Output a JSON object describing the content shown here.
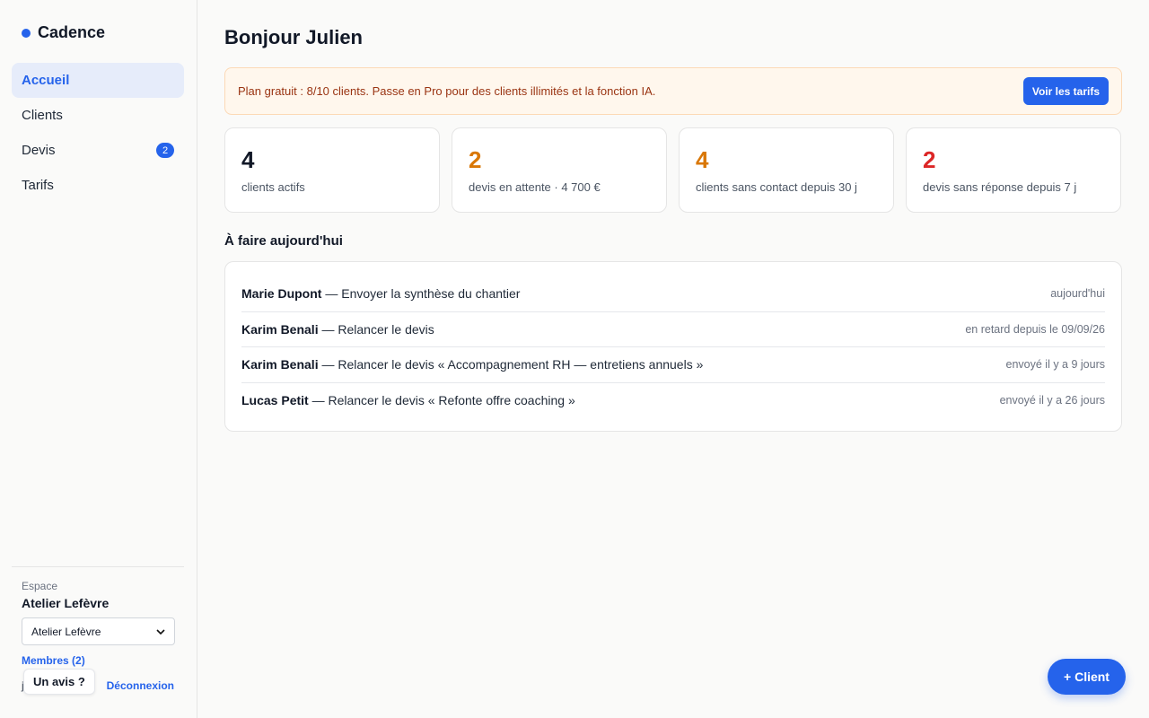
{
  "colors": {
    "accent": "#2563eb",
    "orange": "#d97706",
    "red": "#dc2626",
    "banner_bg": "#fff7ed",
    "banner_text": "#9a3412"
  },
  "sidebar": {
    "brand": "Cadence",
    "items": [
      {
        "label": "Accueil",
        "active": true,
        "badge": ""
      },
      {
        "label": "Clients",
        "active": false,
        "badge": ""
      },
      {
        "label": "Devis",
        "active": false,
        "badge": "2"
      },
      {
        "label": "Tarifs",
        "active": false,
        "badge": ""
      }
    ],
    "footer": {
      "space_label": "Espace",
      "space_name": "Atelier Lefèvre",
      "space_select_value": "Atelier Lefèvre",
      "members_link": "Membres (2)",
      "feedback_button": "Un avis ?",
      "stub_letter": "j",
      "logout": "Déconnexion"
    }
  },
  "main": {
    "greeting": "Bonjour Julien",
    "banner": {
      "text": "Plan gratuit : 8/10 clients. Passe en Pro pour des clients illimités et la fonction IA.",
      "button": "Voir les tarifs"
    },
    "stats": [
      {
        "value": "4",
        "label": "clients actifs",
        "color": "#111827"
      },
      {
        "value": "2",
        "label": "devis en attente · 4 700 €",
        "color": "#d97706"
      },
      {
        "value": "4",
        "label": "clients sans contact depuis 30 j",
        "color": "#d97706"
      },
      {
        "value": "2",
        "label": "devis sans réponse depuis 7 j",
        "color": "#dc2626"
      }
    ],
    "todo_title": "À faire aujourd'hui",
    "todo": [
      {
        "name": "Marie Dupont",
        "action": " — Envoyer la synthèse du chantier",
        "date": "aujourd'hui"
      },
      {
        "name": "Karim Benali",
        "action": " — Relancer le devis",
        "date": "en retard depuis le 09/09/26"
      },
      {
        "name": "Karim Benali",
        "action": " — Relancer le devis « Accompagnement RH — entretiens annuels »",
        "date": "envoyé il y a 9 jours"
      },
      {
        "name": "Lucas Petit",
        "action": " — Relancer le devis « Refonte offre coaching »",
        "date": "envoyé il y a 26 jours"
      }
    ]
  },
  "fab": {
    "label": "+ Client"
  }
}
